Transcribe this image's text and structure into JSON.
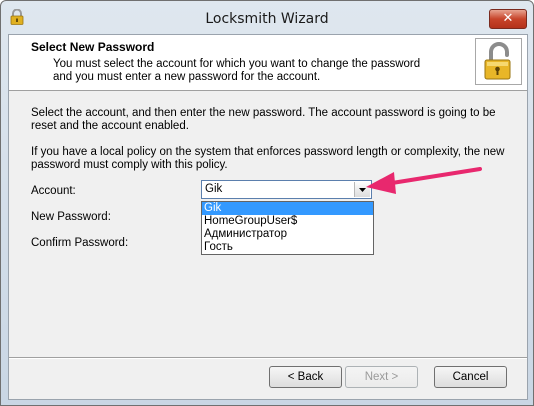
{
  "window": {
    "title": "Locksmith Wizard",
    "close_label": "✕"
  },
  "header": {
    "title": "Select New Password",
    "description": "You must select the account for which you want to change the password and you must enter a new password for the account."
  },
  "body": {
    "paragraph1": "Select the account, and then enter the new password. The account password is going to be reset and the account enabled.",
    "paragraph2": "If you have a local policy on the system that enforces password length or complexity, the new password must comply with this policy."
  },
  "form": {
    "account_label": "Account:",
    "new_password_label": "New Password:",
    "confirm_password_label": "Confirm Password:",
    "account_value": "Gik",
    "options": [
      "Gik",
      "HomeGroupUser$",
      "Администратор",
      "Гость"
    ],
    "selected_index": 0
  },
  "buttons": {
    "back": "< Back",
    "next": "Next >",
    "cancel": "Cancel"
  },
  "colors": {
    "selection": "#3399ff",
    "arrow": "#e8286e",
    "close": "#c7442a"
  },
  "icons": {
    "app": "padlock-icon",
    "header": "padlock-icon",
    "dropdown": "chevron-down-icon"
  }
}
